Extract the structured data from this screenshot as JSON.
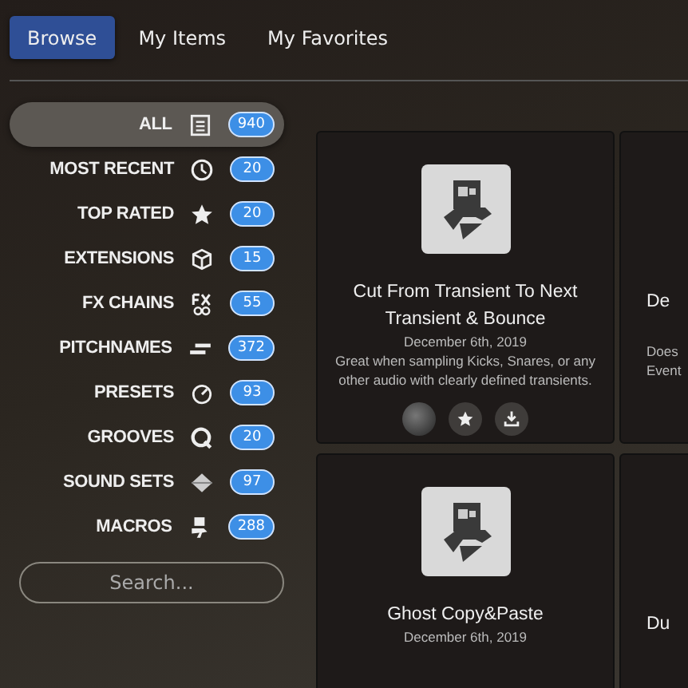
{
  "tabs": [
    {
      "label": "Browse",
      "selected": true
    },
    {
      "label": "My Items",
      "selected": false
    },
    {
      "label": "My Favorites",
      "selected": false
    }
  ],
  "categories": [
    {
      "label": "ALL",
      "kind": "list",
      "count": "940",
      "selected": true
    },
    {
      "label": "MOST RECENT",
      "kind": "clock",
      "count": "20",
      "selected": false
    },
    {
      "label": "TOP RATED",
      "kind": "star",
      "count": "20",
      "selected": false
    },
    {
      "label": "EXTENSIONS",
      "kind": "box",
      "count": "15",
      "selected": false
    },
    {
      "label": "FX CHAINS",
      "kind": "fx",
      "count": "55",
      "selected": false
    },
    {
      "label": "PITCHNAMES",
      "kind": "bars",
      "count": "372",
      "selected": false
    },
    {
      "label": "PRESETS",
      "kind": "gauge",
      "count": "93",
      "selected": false
    },
    {
      "label": "GROOVES",
      "kind": "q",
      "count": "20",
      "selected": false
    },
    {
      "label": "SOUND SETS",
      "kind": "diamond",
      "count": "97",
      "selected": false
    },
    {
      "label": "MACROS",
      "kind": "macro",
      "count": "288",
      "selected": false
    }
  ],
  "search": {
    "placeholder": "Search..."
  },
  "cards": [
    {
      "kind": "full",
      "title": "Cut From Transient To Next Transient & Bounce",
      "date": "December 6th, 2019",
      "description": "Great when sampling Kicks, Snares, or any other audio with clearly defined transients."
    },
    {
      "kind": "clipped",
      "title": "De",
      "description": "Does Event"
    },
    {
      "kind": "full",
      "title": "Ghost Copy&Paste",
      "date": "December 6th, 2019"
    },
    {
      "kind": "clipped",
      "title": "Du"
    }
  ]
}
